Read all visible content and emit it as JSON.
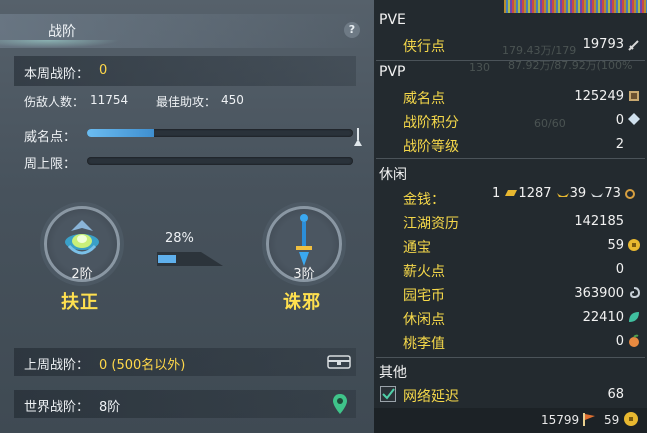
{
  "left_panel": {
    "title": "战阶",
    "help_label": "?",
    "weekly_label": "本周战阶：",
    "weekly_value": "0",
    "kills_label": "伤敌人数：",
    "kills_value": "11754",
    "assist_label": "最佳助攻：",
    "assist_value": "450",
    "fame_label": "威名点：",
    "fame_progress": 0.25,
    "weekly_cap_label": "周上限：",
    "weekly_cap_progress": 0,
    "current_tier": "2阶",
    "current_rank": "扶正",
    "progress_pct": "28%",
    "next_tier": "3阶",
    "next_rank": "诛邪",
    "last_week_label": "上周战阶：",
    "last_week_value": "0 (500名以外)",
    "world_label": "世界战阶：",
    "world_value": "8阶"
  },
  "right_panel": {
    "pve": {
      "section": "PVE",
      "items": [
        {
          "label": "侠行点",
          "value": "19793",
          "icon": "sword-icon"
        }
      ]
    },
    "pvp": {
      "section": "PVP",
      "items": [
        {
          "label": "威名点",
          "value": "125249",
          "icon": "banner-icon"
        },
        {
          "label": "战阶积分",
          "value": "0",
          "icon": "diamond-icon"
        },
        {
          "label": "战阶等级",
          "value": "2",
          "icon": ""
        }
      ]
    },
    "leisure": {
      "section": "休闲",
      "money_label": "金钱：",
      "money_gold_bar": "1",
      "money_gold": "1287",
      "money_silver": "39",
      "money_copper": "73",
      "items": [
        {
          "label": "江湖资历",
          "value": "142185",
          "icon": ""
        },
        {
          "label": "通宝",
          "value": "59",
          "icon": "coin-icon"
        },
        {
          "label": "薪火点",
          "value": "0",
          "icon": ""
        },
        {
          "label": "园宅币",
          "value": "363900",
          "icon": "swirl-icon"
        },
        {
          "label": "休闲点",
          "value": "22410",
          "icon": "leaf-icon"
        },
        {
          "label": "桃李值",
          "value": "0",
          "icon": "peach-icon"
        }
      ]
    },
    "other": {
      "section": "其他",
      "network_label": "网络延迟",
      "network_value": "68"
    },
    "background_text": {
      "hp1": "179.43万/179",
      "hp2": "87.92万/87.92万(100%",
      "level": "130",
      "mp": "60/60"
    },
    "footer": {
      "left_value": "15799",
      "right_value": "59"
    }
  }
}
